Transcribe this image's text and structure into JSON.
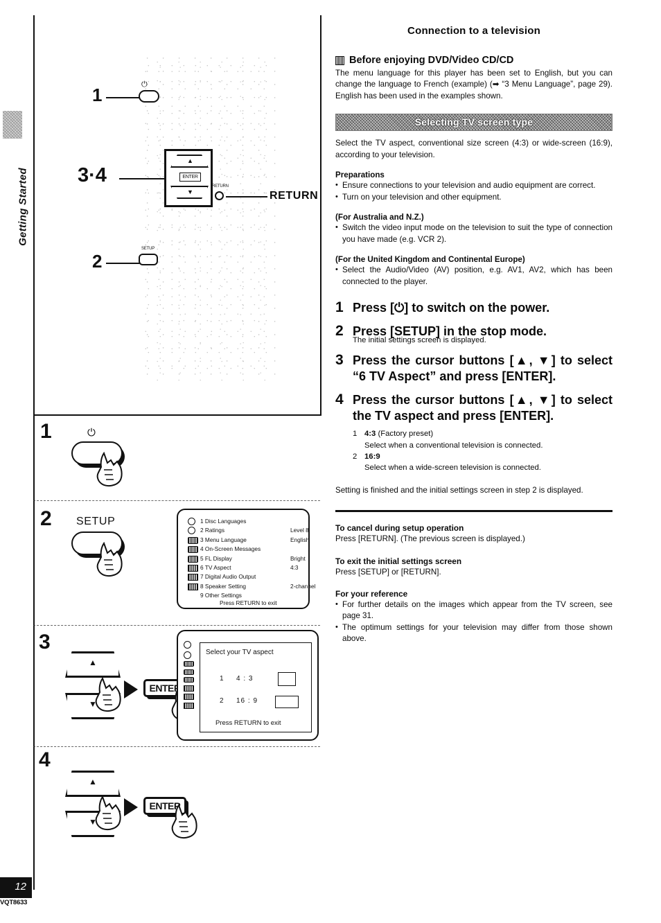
{
  "side_tab": {
    "label": "Getting Started"
  },
  "remote_diagram": {
    "callout_power": "1",
    "callout_cursor": "3·4",
    "callout_setup": "2",
    "power_glyph": "⏻",
    "enter_chip": "ENTER",
    "return_micro": "RETURN",
    "return_label": "RETURN",
    "setup_micro": "SETUP",
    "up_glyph": "▲",
    "down_glyph": "▼"
  },
  "steps": [
    {
      "num": "1",
      "button_label": "",
      "power_glyph": "⏻"
    },
    {
      "num": "2",
      "button_label": "SETUP"
    },
    {
      "num": "3",
      "enter_label": "ENTER"
    },
    {
      "num": "4",
      "enter_label": "ENTER"
    }
  ],
  "setup_screen": {
    "rows": [
      {
        "icon": "disc-icon",
        "label": "1 Disc Languages",
        "value": ""
      },
      {
        "icon": "disc-icon",
        "label": "2 Ratings",
        "value": "Level 8"
      },
      {
        "icon": "card-icon",
        "label": "3 Menu Language",
        "value": "English"
      },
      {
        "icon": "card-icon",
        "label": "4 On-Screen Messages",
        "value": ""
      },
      {
        "icon": "card-icon",
        "label": "5 FL Display",
        "value": "Bright"
      },
      {
        "icon": "grid-icon",
        "label": "6 TV Aspect",
        "value": "4:3"
      },
      {
        "icon": "grid-icon",
        "label": "7 Digital Audio Output",
        "value": ""
      },
      {
        "icon": "grid-icon",
        "label": "8 Speaker Setting",
        "value": "2-channel"
      },
      {
        "icon": "none",
        "label": "9 Other Settings",
        "value": ""
      }
    ],
    "footer": "Press RETURN to exit"
  },
  "aspect_screen": {
    "title": "Select your TV aspect",
    "option1_num": "1",
    "option1_label": "4 : 3",
    "option2_num": "2",
    "option2_label": "16 : 9",
    "footer": "Press RETURN to exit"
  },
  "right": {
    "title": "Connection to a television",
    "before_heading": "Before enjoying DVD/Video CD/CD",
    "before_body": "The menu language for this player has been set to English, but you can change the language to French (example) (➡ “3 Menu Language”, page 29). English has been used in the examples shown.",
    "banner": "Selecting TV screen type",
    "intro": "Select the TV aspect, conventional size screen (4:3) or wide-screen (16:9), according to your television.",
    "preparations_heading": "Preparations",
    "prep_items": [
      "Ensure connections to your television and audio equipment are correct.",
      "Turn on your television and other equipment."
    ],
    "anz_heading": "(For Australia and N.Z.)",
    "anz_items": [
      "Switch the video input mode on the television to suit the type of connection you have made (e.g. VCR 2)."
    ],
    "uk_heading": "(For the United Kingdom and Continental Europe)",
    "uk_items": [
      "Select the Audio/Video (AV) position, e.g. AV1, AV2, which has been connected to the player."
    ],
    "step1_num": "1",
    "step1_text": "Press [⏻] to switch on the power.",
    "step2_num": "2",
    "step2_text": "Press [SETUP] in the stop mode.",
    "step2_note": "The initial settings screen is displayed.",
    "step3_num": "3",
    "step3_text": "Press the cursor buttons [▲, ▼] to select “6 TV Aspect” and press [ENTER].",
    "step4_num": "4",
    "step4_text": "Press the cursor buttons [▲, ▼] to select the TV aspect and press [ENTER].",
    "opt1_num": "1",
    "opt1_label": "4:3",
    "opt1_paren": "(Factory preset)",
    "opt1_desc": "Select when a conventional television is connected.",
    "opt2_num": "2",
    "opt2_label": "16:9",
    "opt2_paren": "",
    "opt2_desc": "Select when a wide-screen television is connected.",
    "closing": "Setting is finished and the initial settings screen in step 2 is displayed.",
    "cancel_heading": "To cancel during setup operation",
    "cancel_body": "Press [RETURN]. (The previous screen is displayed.)",
    "exit_heading": "To exit the initial settings screen",
    "exit_body": "Press [SETUP] or [RETURN].",
    "reference_heading": "For your reference",
    "reference_items": [
      "For further details on the images which appear from the TV screen, see page 31.",
      "The optimum settings for your television may differ from those shown above."
    ]
  },
  "footer": {
    "page_number": "12",
    "doc_code": "VQT8633"
  }
}
